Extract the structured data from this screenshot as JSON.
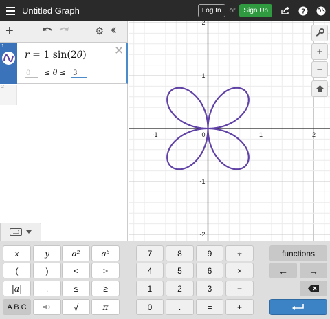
{
  "header": {
    "title": "Untitled Graph",
    "login_label": "Log In",
    "or_label": "or",
    "signup_label": "Sign Up"
  },
  "expressions": [
    {
      "number": "1",
      "formula": {
        "lhs": "r",
        "eq": "= 1 sin(2",
        "var": "θ",
        "close": ")"
      },
      "domain": {
        "min_placeholder": "0",
        "mid": "≤ θ ≤",
        "max_value": "3"
      },
      "color": "#6042a6"
    },
    {
      "number": "2"
    }
  ],
  "graph": {
    "x_ticks": [
      "-1",
      "1",
      "2"
    ],
    "y_ticks": [
      "2",
      "1",
      "-1",
      "-2"
    ],
    "origin_label": "0",
    "curve_color": "#6042a6"
  },
  "keypad": {
    "left": [
      [
        "x",
        "y",
        "a²",
        "aᵇ"
      ],
      [
        "(",
        ")",
        "<",
        ">"
      ],
      [
        "|a|",
        ",",
        "≤",
        "≥"
      ],
      [
        "A B C",
        "speaker",
        "√",
        "π"
      ]
    ],
    "middle": [
      [
        "7",
        "8",
        "9",
        "÷"
      ],
      [
        "4",
        "5",
        "6",
        "×"
      ],
      [
        "1",
        "2",
        "3",
        "−"
      ],
      [
        "0",
        ".",
        "=",
        "+"
      ]
    ],
    "functions_label": "functions",
    "left_arrow": "←",
    "right_arrow": "→"
  },
  "colors": {
    "accent": "#3a73b9",
    "topbar": "#2a2a2a",
    "signup": "#2f9a3f",
    "curve": "#6042a6"
  }
}
